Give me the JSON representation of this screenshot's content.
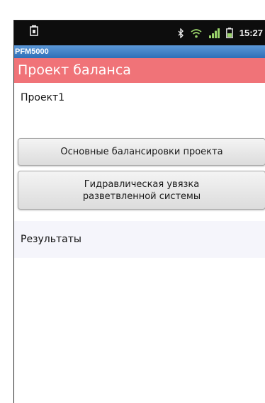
{
  "status_bar": {
    "time": "15:27",
    "icons": [
      "sim-card-icon",
      "bluetooth-icon",
      "wifi-icon",
      "signal-icon",
      "battery-icon"
    ]
  },
  "app": {
    "title": "PFM5000"
  },
  "screen": {
    "header": "Проект баланса",
    "project_name": "Проект1",
    "buttons": {
      "main_balancing": "Основные балансировки проекта",
      "hydraulic": "Гидравлическая увязка разветвленной системы"
    },
    "results_label": "Результаты"
  },
  "colors": {
    "header_bg": "#f07378",
    "title_bar_bg": "#3d7fc7",
    "status_bar_bg": "#0d0d0d"
  }
}
